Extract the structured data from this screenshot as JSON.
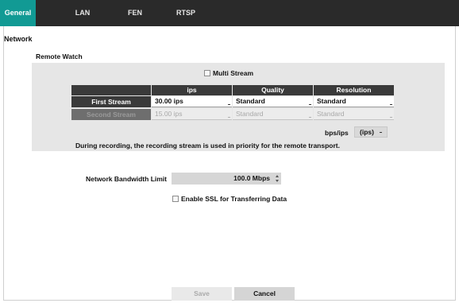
{
  "tabs": [
    {
      "label": "General",
      "active": true
    },
    {
      "label": "LAN",
      "active": false
    },
    {
      "label": "FEN",
      "active": false
    },
    {
      "label": "RTSP",
      "active": false
    }
  ],
  "section_title": "Network",
  "remote_watch": {
    "title": "Remote Watch",
    "multi_stream_label": "Multi Stream",
    "multi_stream_checked": false,
    "columns": [
      "ips",
      "Quality",
      "Resolution"
    ],
    "rows": [
      {
        "label": "First Stream",
        "ips": "30.00 ips",
        "quality": "Standard",
        "resolution": "Standard",
        "enabled": true
      },
      {
        "label": "Second Stream",
        "ips": "15.00 ips",
        "quality": "Standard",
        "resolution": "Standard",
        "enabled": false
      }
    ],
    "unit_label": "bps/ips",
    "unit_value": "(ips)",
    "note": "During recording, the recording stream is used in priority for the remote transport."
  },
  "bandwidth": {
    "label": "Network Bandwidth Limit",
    "value": "100.0 Mbps"
  },
  "ssl": {
    "label": "Enable SSL for Transferring Data",
    "checked": false
  },
  "buttons": {
    "save": "Save",
    "cancel": "Cancel"
  },
  "colors": {
    "accent": "#119a94",
    "tabbar": "#2a2a2a",
    "panel": "#e6e6e6",
    "header": "#3a3a3a"
  }
}
